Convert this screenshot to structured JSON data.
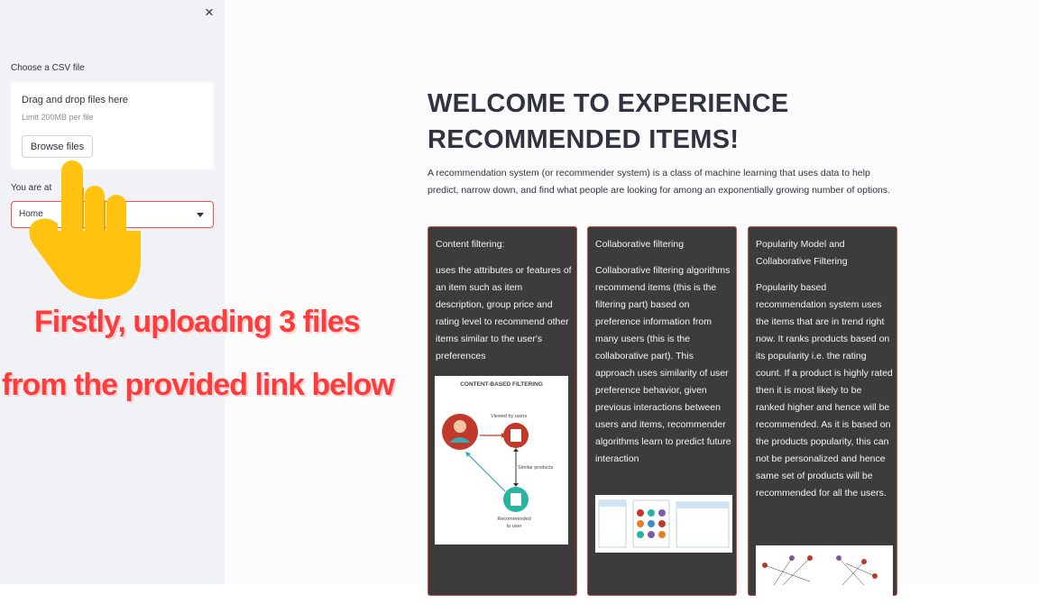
{
  "sidebar": {
    "close_symbol": "×",
    "uploader": {
      "label": "Choose a CSV file",
      "drop_title": "Drag and drop files here",
      "limit": "Limit 200MB per file",
      "browse_label": "Browse files"
    },
    "select": {
      "label": "You are at",
      "value": "Home"
    }
  },
  "overlay": {
    "line1": "Firstly, uploading 3 files",
    "line2": "from the provided link below",
    "hand_icon": "pointing-hand-icon"
  },
  "main": {
    "title": "WELCOME TO EXPERIENCE RECOMMENDED ITEMS!",
    "intro": "A recommendation system (or recommender system) is a class of machine learning that uses data to help predict, narrow down, and find what people are looking for among an exponentially growing number of options.",
    "cards": [
      {
        "title": "Content filtering:",
        "body": "uses the attributes or features of an item such as item description, group price and rating level to recommend other items similar to the user's preferences",
        "image": {
          "title": "CONTENT-BASED FILTERING",
          "viewed": "Viewed by users",
          "similar": "Similar products",
          "recommended": "Recommended to user"
        }
      },
      {
        "title": "Collaborative filtering",
        "body": "Collaborative filtering algorithms recommend items (this is the filtering part) based on preference information from many users (this is the collaborative part). This approach uses similarity of user preference behavior, given previous interactions between users and items, recommender algorithms learn to predict future interaction"
      },
      {
        "title": "Popularity Model and Collaborative Filtering",
        "body": "Popularity based recommendation system uses the items that are in trend right now. It ranks products based on its popularity i.e. the rating count. If a product is highly rated then it is most likely to be ranked higher and hence will be recommended. As it is based on the products popularity, this can not be personalized and hence same set of products will be recommended for all the users."
      }
    ]
  },
  "colors": {
    "sidebar_bg": "#f0f2f6",
    "card_bg": "#3d3b3c",
    "accent": "#ff4b4b",
    "overlay_text": "#ff3b3b",
    "hand": "#ffc20e"
  }
}
